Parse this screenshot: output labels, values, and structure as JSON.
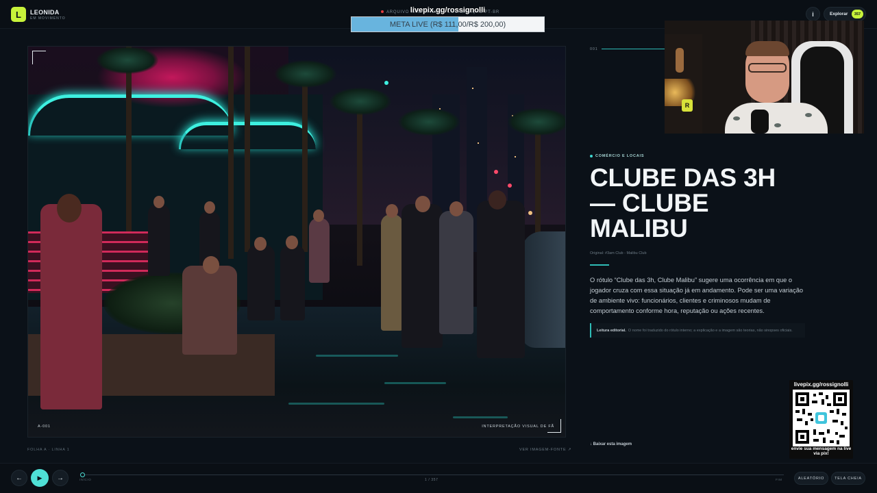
{
  "header": {
    "logo_letter": "L",
    "brand_name": "LEONIDA",
    "brand_tagline": "EM MOVIMENTO",
    "archive_notice": "ARQUIVO NÃO OFICIAL · LOCALIZAÇÃO PT-BR",
    "info_label": "i",
    "explore_label": "Explorar",
    "explore_count": "357"
  },
  "overlay": {
    "livepix_url": "livepix.gg/rossignolli",
    "meta_label": "META LIVE (R$ 111,00/R$ 200,00)",
    "meta_current": 111,
    "meta_goal": 200,
    "meta_fill_color": "#68b4de",
    "qr_title": "livepix.gg/rossignolli",
    "qr_caption": "envie sua mensagem na live via pix!",
    "webcam_cube_letter": "R"
  },
  "image": {
    "code": "A-001",
    "caption": "INTERPRETAÇÃO VISUAL DE FÃ",
    "sheet_info": "FOLHA A · LINHA 1",
    "source_link": "VER IMAGEM-FONTE ↗"
  },
  "detail": {
    "index": "001",
    "category": "COMÉRCIO E LOCAIS",
    "title": "CLUBE DAS 3H — CLUBE MALIBU",
    "original": "Original: #3am Club - Malibu Club",
    "description": "O rótulo “Clube das 3h, Clube Malibu” sugere uma ocorrência em que o jogador cruza com essa situação já em andamento. Pode ser uma variação de ambiente vivo: funcionários, clientes e criminosos mudam de comportamento conforme hora, reputação ou ações recentes.",
    "note_label": "Leitura editorial.",
    "note_text": "O nome foi traduzido do rótulo interno; a explicação e a imagem são teorias, não sinopses oficiais.",
    "download_label": "↓ Baixar esta imagem",
    "accent_color": "#2fbdb7"
  },
  "controls": {
    "prev_icon": "←",
    "play_icon": "▶",
    "next_icon": "→",
    "track_start": "INÍCIO",
    "track_count": "1 / 357",
    "track_end": "FIM",
    "progress_value": 1,
    "progress_total": 357,
    "random_label": "ALEATÓRIO",
    "fullscreen_label": "TELA CHEIA",
    "accent_color": "#4fe0d6"
  }
}
